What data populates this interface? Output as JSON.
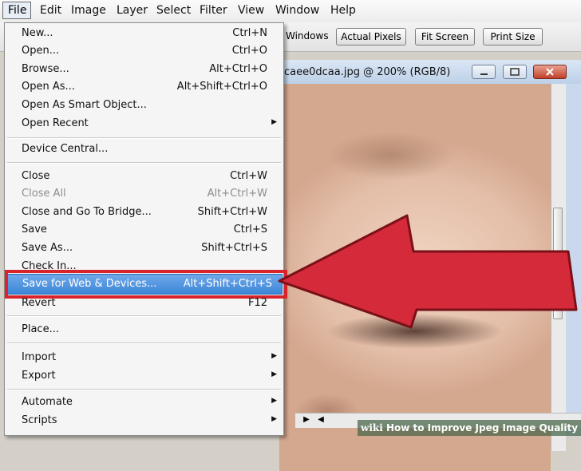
{
  "menubar": {
    "items": [
      "File",
      "Edit",
      "Image",
      "Layer",
      "Select",
      "Filter",
      "View",
      "Window",
      "Help"
    ]
  },
  "options_bar": {
    "windows_label": "Windows",
    "buttons": [
      "Actual Pixels",
      "Fit Screen",
      "Print Size"
    ]
  },
  "document": {
    "title": "caee0dcaa.jpg @ 200% (RGB/8)"
  },
  "file_menu": {
    "items": [
      {
        "label": "New...",
        "shortcut": "Ctrl+N"
      },
      {
        "label": "Open...",
        "shortcut": "Ctrl+O"
      },
      {
        "label": "Browse...",
        "shortcut": "Alt+Ctrl+O"
      },
      {
        "label": "Open As...",
        "shortcut": "Alt+Shift+Ctrl+O"
      },
      {
        "label": "Open As Smart Object...",
        "shortcut": ""
      },
      {
        "label": "Open Recent",
        "shortcut": ""
      },
      {
        "label": "Device Central...",
        "shortcut": ""
      },
      {
        "label": "Close",
        "shortcut": "Ctrl+W"
      },
      {
        "label": "Close All",
        "shortcut": "Alt+Ctrl+W"
      },
      {
        "label": "Close and Go To Bridge...",
        "shortcut": "Shift+Ctrl+W"
      },
      {
        "label": "Save",
        "shortcut": "Ctrl+S"
      },
      {
        "label": "Save As...",
        "shortcut": "Shift+Ctrl+S"
      },
      {
        "label": "Check In...",
        "shortcut": ""
      },
      {
        "label": "Save for Web & Devices...",
        "shortcut": "Alt+Shift+Ctrl+S"
      },
      {
        "label": "Revert",
        "shortcut": "F12"
      },
      {
        "label": "Place...",
        "shortcut": ""
      },
      {
        "label": "Import",
        "shortcut": ""
      },
      {
        "label": "Export",
        "shortcut": ""
      },
      {
        "label": "Automate",
        "shortcut": ""
      },
      {
        "label": "Scripts",
        "shortcut": ""
      }
    ]
  },
  "banner": {
    "wiki": "wiki",
    "text": "How to Improve Jpeg Image Quality"
  },
  "colors": {
    "highlight": "#3d86d8",
    "annotation_red": "#d8232a",
    "arrow_fill": "#d42a3a"
  }
}
